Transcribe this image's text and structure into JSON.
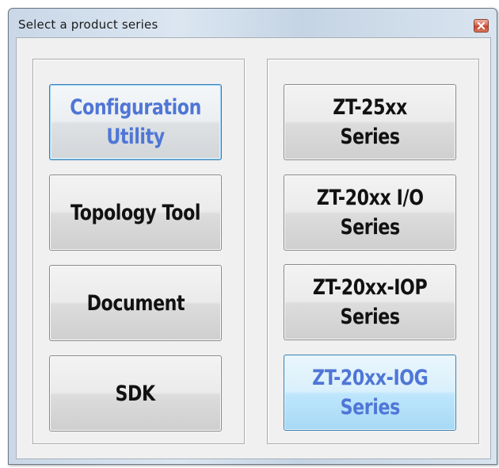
{
  "window": {
    "title": "Select a product series"
  },
  "left_group": {
    "buttons": [
      {
        "label": "Configuration\nUtility",
        "state": "focused"
      },
      {
        "label": "Topology Tool",
        "state": "normal"
      },
      {
        "label": "Document",
        "state": "normal"
      },
      {
        "label": "SDK",
        "state": "normal"
      }
    ]
  },
  "right_group": {
    "buttons": [
      {
        "label": "ZT-25xx\nSeries",
        "state": "normal"
      },
      {
        "label": "ZT-20xx I/O\nSeries",
        "state": "normal"
      },
      {
        "label": "ZT-20xx-IOP\nSeries",
        "state": "normal"
      },
      {
        "label": "ZT-20xx-IOG\nSeries",
        "state": "hover"
      }
    ]
  },
  "colors": {
    "highlight_text": "#4f76d6",
    "normal_text": "#111111",
    "close_button": "#c1412a"
  },
  "icons": {
    "close": "close-icon"
  }
}
